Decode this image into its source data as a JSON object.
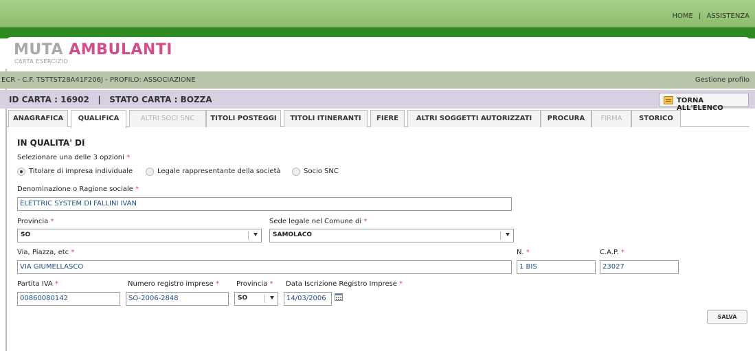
{
  "topbar": {
    "home": "HOME",
    "separator": "|",
    "help": "ASSISTENZA"
  },
  "logo": {
    "part1": "MUTA",
    "part2": "AMBULANTI",
    "subtitle": "CARTA ESERCIZIO"
  },
  "userbar": {
    "left": "ECR - C.F. TSTTST28A41F206J - PROFILO: ASSOCIAZIONE",
    "right": "Gestione profilo"
  },
  "cardbar": {
    "title": "ID CARTA : 16902   |   STATO CARTA : BOZZA",
    "back_button": "TORNA ALL'ELENCO"
  },
  "tabs": [
    {
      "label": "ANAGRAFICA",
      "state": "normal"
    },
    {
      "label": "QUALIFICA",
      "state": "active"
    },
    {
      "label": "ALTRI SOCI SNC",
      "state": "disabled"
    },
    {
      "label": "TITOLI POSTEGGI",
      "state": "normal"
    },
    {
      "label": "TITOLI ITINERANTI",
      "state": "normal"
    },
    {
      "label": "FIERE",
      "state": "normal"
    },
    {
      "label": "ALTRI SOGGETTI AUTORIZZATI",
      "state": "normal"
    },
    {
      "label": "PROCURA",
      "state": "normal"
    },
    {
      "label": "FIRMA",
      "state": "disabled"
    },
    {
      "label": "STORICO",
      "state": "normal"
    }
  ],
  "form": {
    "section_title": "IN QUALITA' DI",
    "select_prompt": "Selezionare una delle 3 opzioni",
    "required_mark": "*",
    "options": [
      {
        "label": "Titolare di impresa individuale",
        "selected": true
      },
      {
        "label": "Legale rappresentante della società",
        "selected": false
      },
      {
        "label": "Socio SNC",
        "selected": false
      }
    ],
    "denominazione": {
      "label": "Denominazione o Ragione sociale",
      "value": "ELETTRIC SYSTEM DI FALLINI IVAN"
    },
    "provincia": {
      "label": "Provincia",
      "value": "SO"
    },
    "sede_comune": {
      "label": "Sede legale nel Comune di",
      "value": "SAMOLACO"
    },
    "via": {
      "label": "Via, Piazza, etc",
      "value": "VIA GIUMELLASCO"
    },
    "numero": {
      "label": "N.",
      "value": "1 BIS"
    },
    "cap": {
      "label": "C.A.P.",
      "value": "23027"
    },
    "partita_iva": {
      "label": "Partita IVA",
      "value": "00860080142"
    },
    "registro": {
      "label": "Numero registro imprese",
      "value": "SO-2006-2848"
    },
    "provincia_reg": {
      "label": "Provincia",
      "value": "SO"
    },
    "data_iscrizione": {
      "label": "Data Iscrizione Registro Imprese",
      "value": "14/03/2006"
    },
    "save_button": "SALVA"
  },
  "colors": {
    "brand_pink": "#d14e8a",
    "green": "#2f8a23",
    "required": "#d8387a",
    "input_text": "#1f4f8a"
  }
}
